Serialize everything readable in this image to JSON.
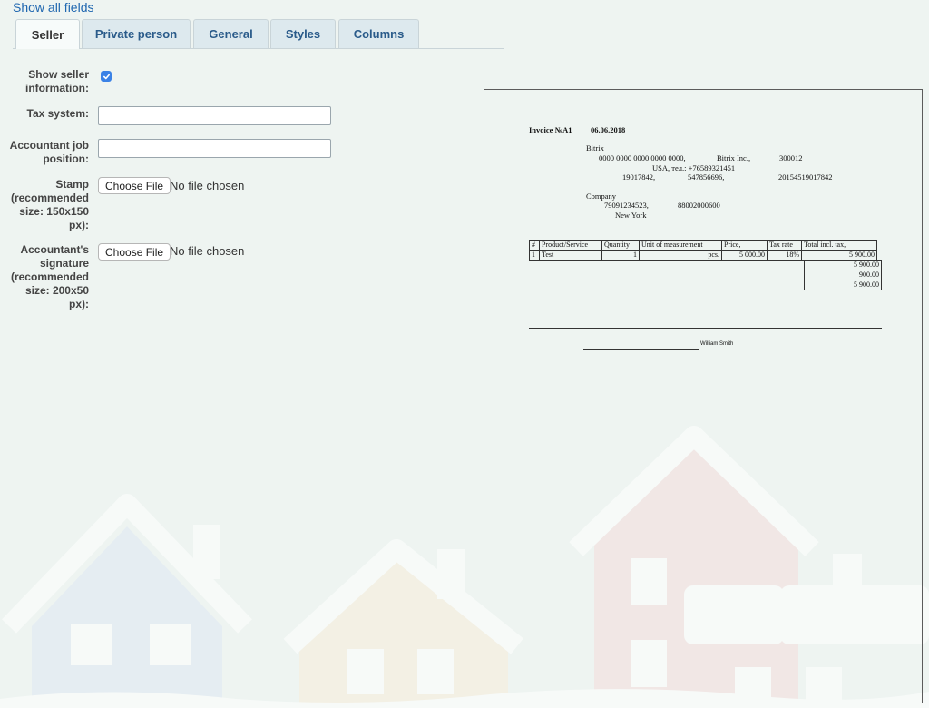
{
  "top_link": "Show all fields",
  "tabs": [
    "Seller",
    "Private person",
    "General",
    "Styles",
    "Columns"
  ],
  "active_tab": "Seller",
  "form": {
    "show_seller_label": "Show seller information:",
    "show_seller_checked": true,
    "tax_system_label": "Tax system:",
    "tax_system_value": "",
    "accountant_label": "Accountant job position:",
    "accountant_value": "",
    "stamp_label": "Stamp (recommended size: 150x150 px):",
    "signature_label": "Accountant's signature (recommended size: 200x50 px):",
    "choose_file": "Choose File",
    "no_file": "No file chosen"
  },
  "invoice": {
    "title": "Invoice №A1",
    "date": "06.06.2018",
    "seller_name": "Bitrix",
    "seller_line1": "0000 0000 0000 0000 0000,",
    "seller_company": "Bitrix Inc.,",
    "seller_zip": "300012",
    "seller_phone": "USA, тел.: +76589321451",
    "seller_id1": "19017842,",
    "seller_id2": "547856696,",
    "seller_id3": "20154519017842",
    "buyer_name": "Company",
    "buyer_id1": "79091234523,",
    "buyer_id2": "88002000600",
    "buyer_city": "New York",
    "table_headers": [
      "#",
      "Product/Service",
      "Quantity",
      "Unit of measurement",
      "Price,",
      "Tax rate",
      "Total incl. tax,"
    ],
    "row": [
      "1",
      "Test",
      "1",
      "pcs.",
      "5 000.00",
      "18%",
      "5 900.00"
    ],
    "totals": [
      "5 900.00",
      "900.00",
      "5 900.00"
    ],
    "dots": ". .",
    "signatory": "William Smith"
  },
  "colors": {
    "link": "#2067b0",
    "checkbox": "#3b82e6",
    "tab_bg": "#dde9ee"
  }
}
